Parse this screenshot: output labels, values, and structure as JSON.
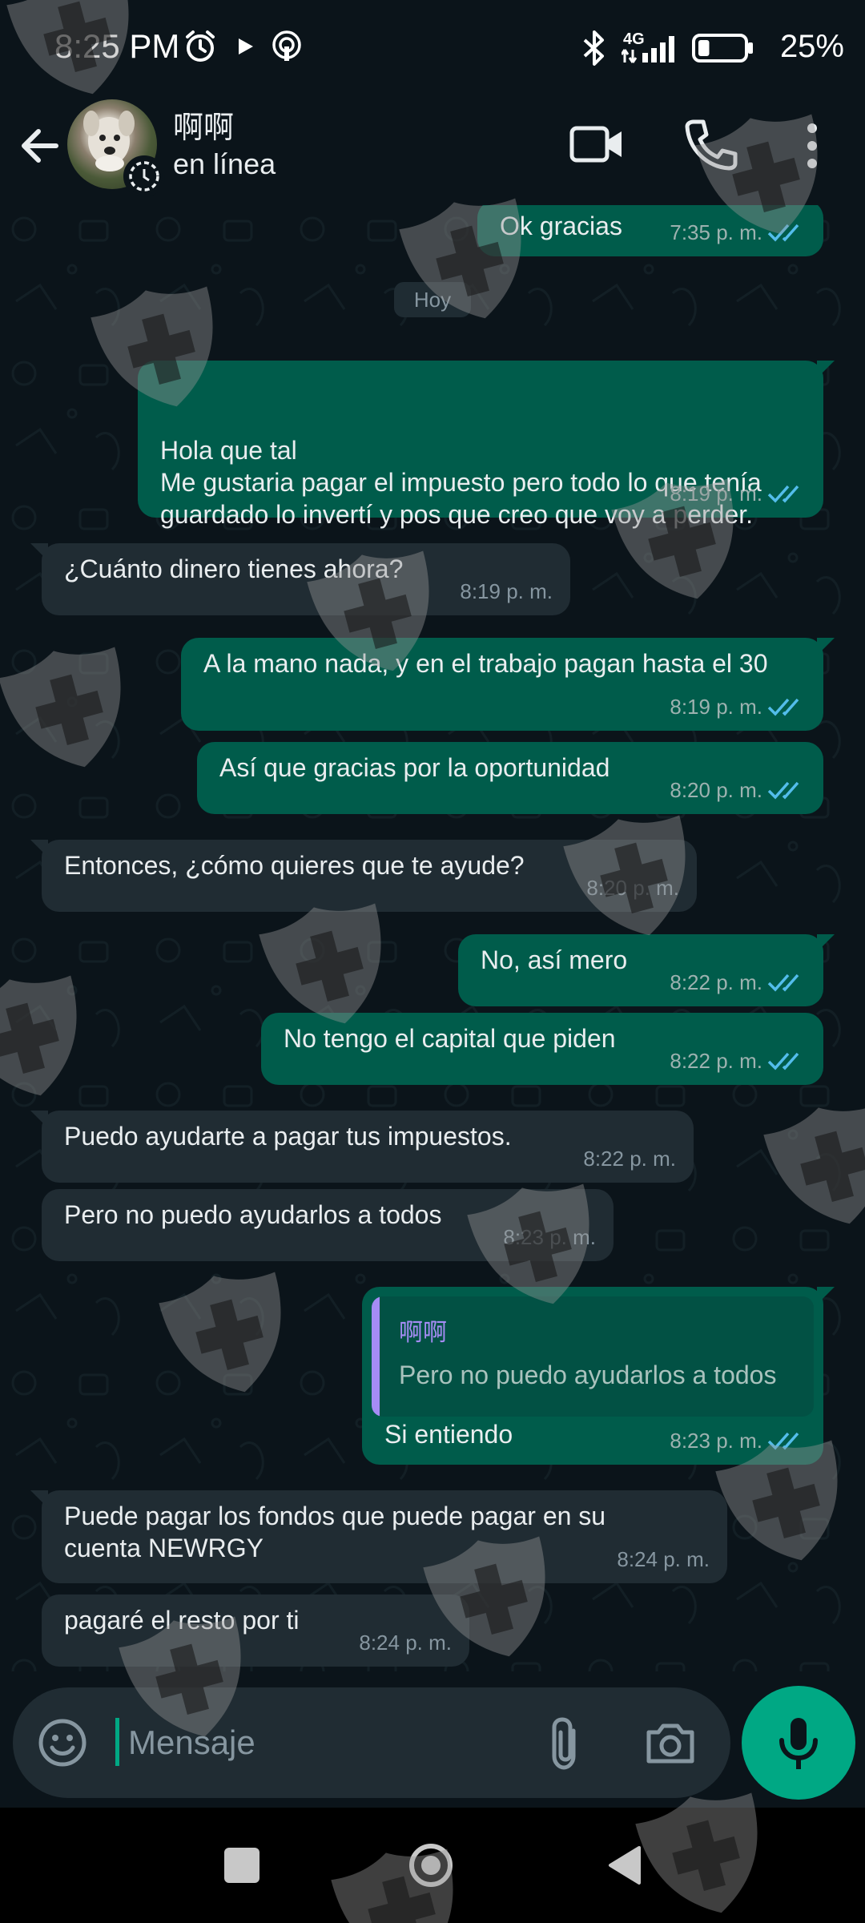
{
  "status_bar": {
    "time": "8:25 PM",
    "network": "4G",
    "battery": "25%",
    "battery_level": 0.25
  },
  "header": {
    "contact_name": "啊啊",
    "contact_status": "en línea"
  },
  "chat": {
    "date_separator": "Hoy",
    "messages": [
      {
        "dir": "out",
        "text": "Ok gracias",
        "time": "7:35 p. m.",
        "read": true
      },
      {
        "dir": "out",
        "text": "Hola que tal\nMe gustaria pagar el impuesto pero todo lo que tenía guardado lo invertí y pos que creo que voy a perder.",
        "time": "8:19 p. m.",
        "read": true
      },
      {
        "dir": "in",
        "text": "¿Cuánto dinero tienes ahora?",
        "time": "8:19 p. m."
      },
      {
        "dir": "out",
        "text": "A la mano nada, y en el trabajo pagan hasta el 30",
        "time": "8:19 p. m.",
        "read": true
      },
      {
        "dir": "out",
        "text": "Así que gracias por la oportunidad",
        "time": "8:20 p. m.",
        "read": true
      },
      {
        "dir": "in",
        "text": "Entonces, ¿cómo quieres que te ayude?",
        "time": "8:20 p. m."
      },
      {
        "dir": "out",
        "text": "No, así mero",
        "time": "8:22 p. m.",
        "read": true
      },
      {
        "dir": "out",
        "text": "No tengo el capital que piden",
        "time": "8:22 p. m.",
        "read": true
      },
      {
        "dir": "in",
        "text": "Puedo ayudarte a pagar tus impuestos.",
        "time": "8:22 p. m."
      },
      {
        "dir": "in",
        "text": "Pero no puedo ayudarlos a todos",
        "time": "8:23 p. m."
      },
      {
        "dir": "out",
        "text": "Si entiendo",
        "time": "8:23 p. m.",
        "read": true,
        "reply_to": {
          "name": "啊啊",
          "text": "Pero no puedo ayudarlos a todos"
        }
      },
      {
        "dir": "in",
        "text": "Puede pagar los fondos que puede pagar en su cuenta NEWRGY",
        "time": "8:24 p. m."
      },
      {
        "dir": "in",
        "text": "pagaré el resto por ti",
        "time": "8:24 p. m."
      }
    ]
  },
  "composer": {
    "placeholder": "Mensaje",
    "value": ""
  },
  "icons": {
    "back": "arrow-left-icon",
    "video": "video-camera-icon",
    "call": "phone-icon",
    "menu": "more-vert-icon",
    "emoji": "smiley-icon",
    "attach": "paperclip-icon",
    "camera": "camera-icon",
    "mic": "microphone-icon"
  },
  "colors": {
    "background": "#0b141a",
    "outgoing_bubble": "#005c4b",
    "incoming_bubble": "#202c33",
    "accent": "#00a884",
    "read_ticks": "#53bdeb",
    "reply_name": "#a58cf5"
  }
}
